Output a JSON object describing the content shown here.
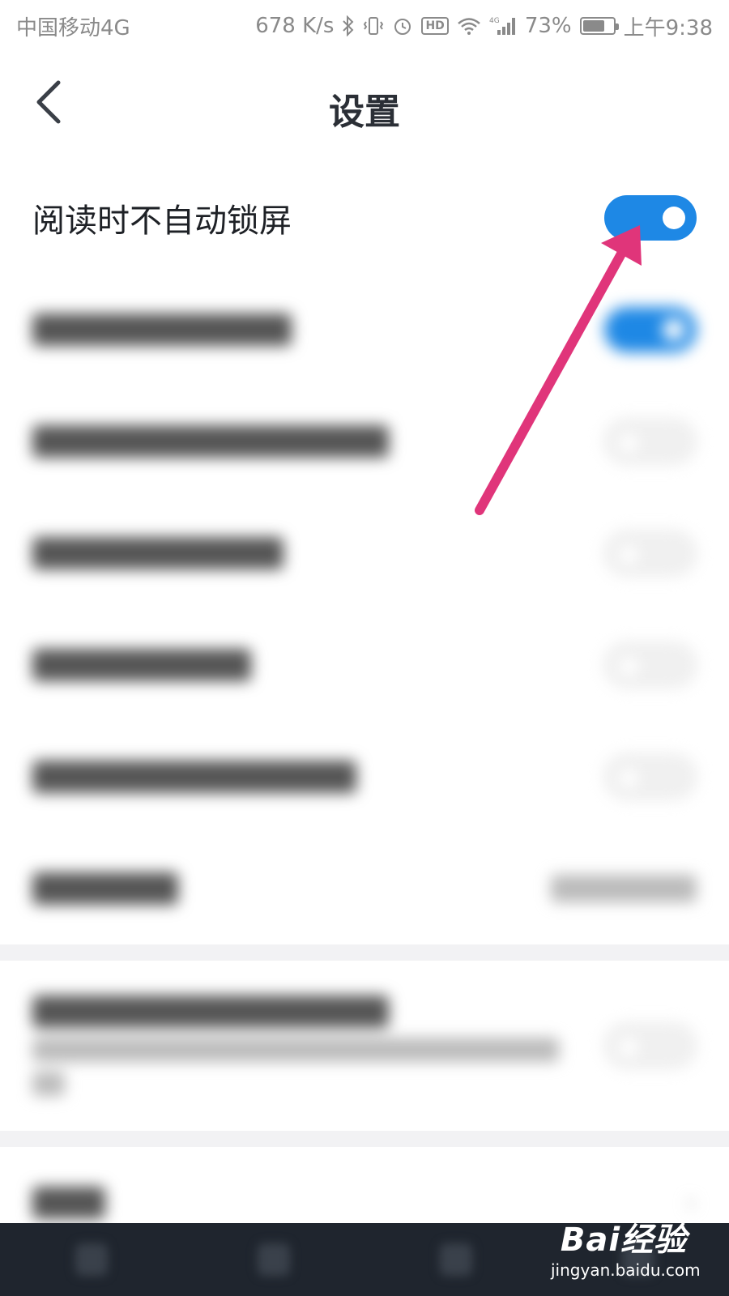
{
  "status_bar": {
    "carrier": "中国移动4G",
    "net_speed": "678 K/s",
    "hd_label": "HD",
    "network_label": "4G",
    "battery_percent": "73%",
    "battery_level": 0.73,
    "time": "上午9:38"
  },
  "header": {
    "title": "设置"
  },
  "settings": {
    "keep_screen_on": {
      "label": "阅读时不自动锁屏",
      "enabled": true
    }
  },
  "watermark": {
    "logo": "Bai经验",
    "url": "jingyan.baidu.com"
  },
  "colors": {
    "toggle_on": "#1e88e5",
    "arrow": "#e0357a",
    "bottom_bar": "#1f252e"
  }
}
